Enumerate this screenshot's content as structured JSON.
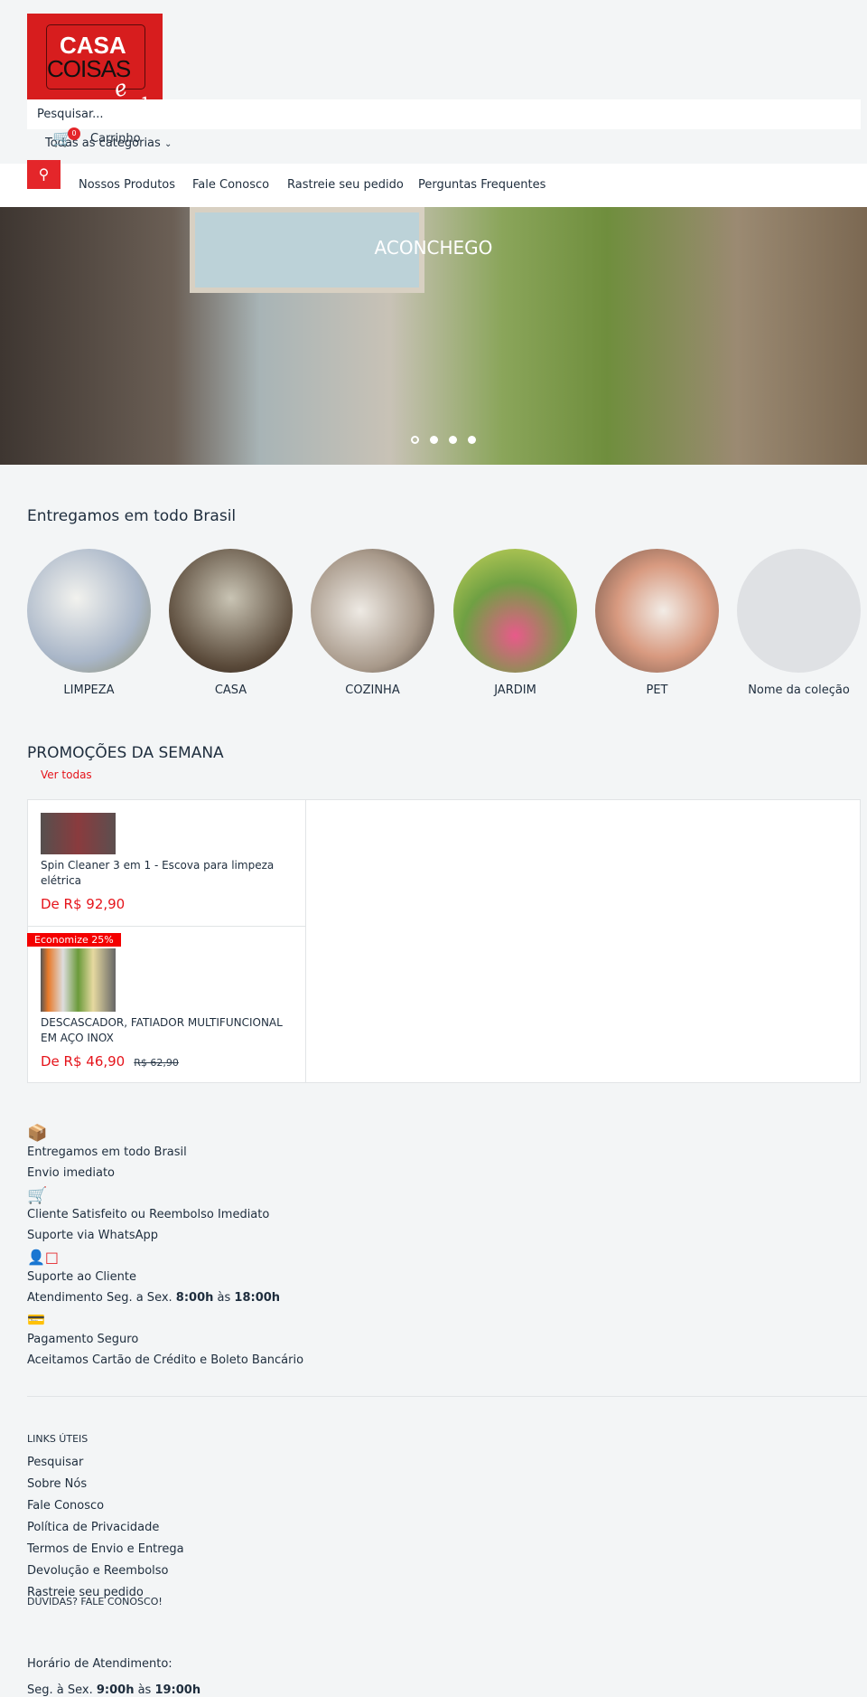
{
  "header": {
    "logo_text": "CASA COISAS e tal",
    "search_placeholder": "Pesquisar...",
    "categories": "Todas as categorias",
    "cart_count": "0",
    "cart_label": "Carrinho"
  },
  "nav": [
    "Nossos Produtos",
    "Fale Conosco",
    "Rastreie seu pedido",
    "Perguntas Frequentes"
  ],
  "hero": {
    "title": "ACONCHEGO",
    "slides": 4,
    "active_slide": 1
  },
  "collections": {
    "title": "Entregamos em todo Brasil",
    "items": [
      "LIMPEZA",
      "CASA",
      "COZINHA",
      "JARDIM",
      "PET",
      "Nome da coleção"
    ]
  },
  "promos": {
    "title": "PROMOÇÕES DA SEMANA",
    "view_all": "Ver todas",
    "products": [
      {
        "name": "Spin Cleaner 3 em 1 - Escova para limpeza elétrica",
        "price": "De R$ 92,90"
      },
      {
        "badge": "Economize 25%",
        "name": "DESCASCADOR, FATIADOR MULTIFUNCIONAL EM AÇO INOX",
        "price": "De R$ 46,90",
        "old_price": "R$ 62,90"
      }
    ]
  },
  "features": [
    {
      "icon": "box-icon",
      "title": "Entregamos em todo Brasil",
      "sub": "Envio imediato"
    },
    {
      "icon": "cart-return-icon",
      "title": "Cliente Satisfeito ou Reembolso Imediato",
      "sub": "Suporte via WhatsApp"
    },
    {
      "icon": "support-icon",
      "title": "Suporte ao Cliente",
      "sub_pre": "Atendimento Seg. a Sex. ",
      "sub_b1": "8:00h",
      "sub_mid": " às ",
      "sub_b2": "18:00h"
    },
    {
      "icon": "secure-card-icon",
      "title": "Pagamento Seguro",
      "sub": "Aceitamos Cartão de Crédito e Boleto Bancário"
    }
  ],
  "footer": {
    "links_title": "LINKS ÚTEIS",
    "links": [
      "Pesquisar",
      "Sobre Nós",
      "Fale Conosco",
      "Política de Privacidade",
      "Termos de Envio e Entrega",
      "Devolução e Reembolso",
      "Rastreie seu pedido"
    ],
    "contact_title": "DÚVIDAS? FALE CONOSCO!",
    "hours_label": "Horário de Atendimento:",
    "hours_pre": "Seg. à Sex. ",
    "hours_b1": "9:00h",
    "hours_mid": " às ",
    "hours_b2": "19:00h"
  },
  "colors": {
    "accent": "#e4262a",
    "price": "#e5141b",
    "text": "#1e2d3d",
    "bg": "#f3f5f6"
  }
}
